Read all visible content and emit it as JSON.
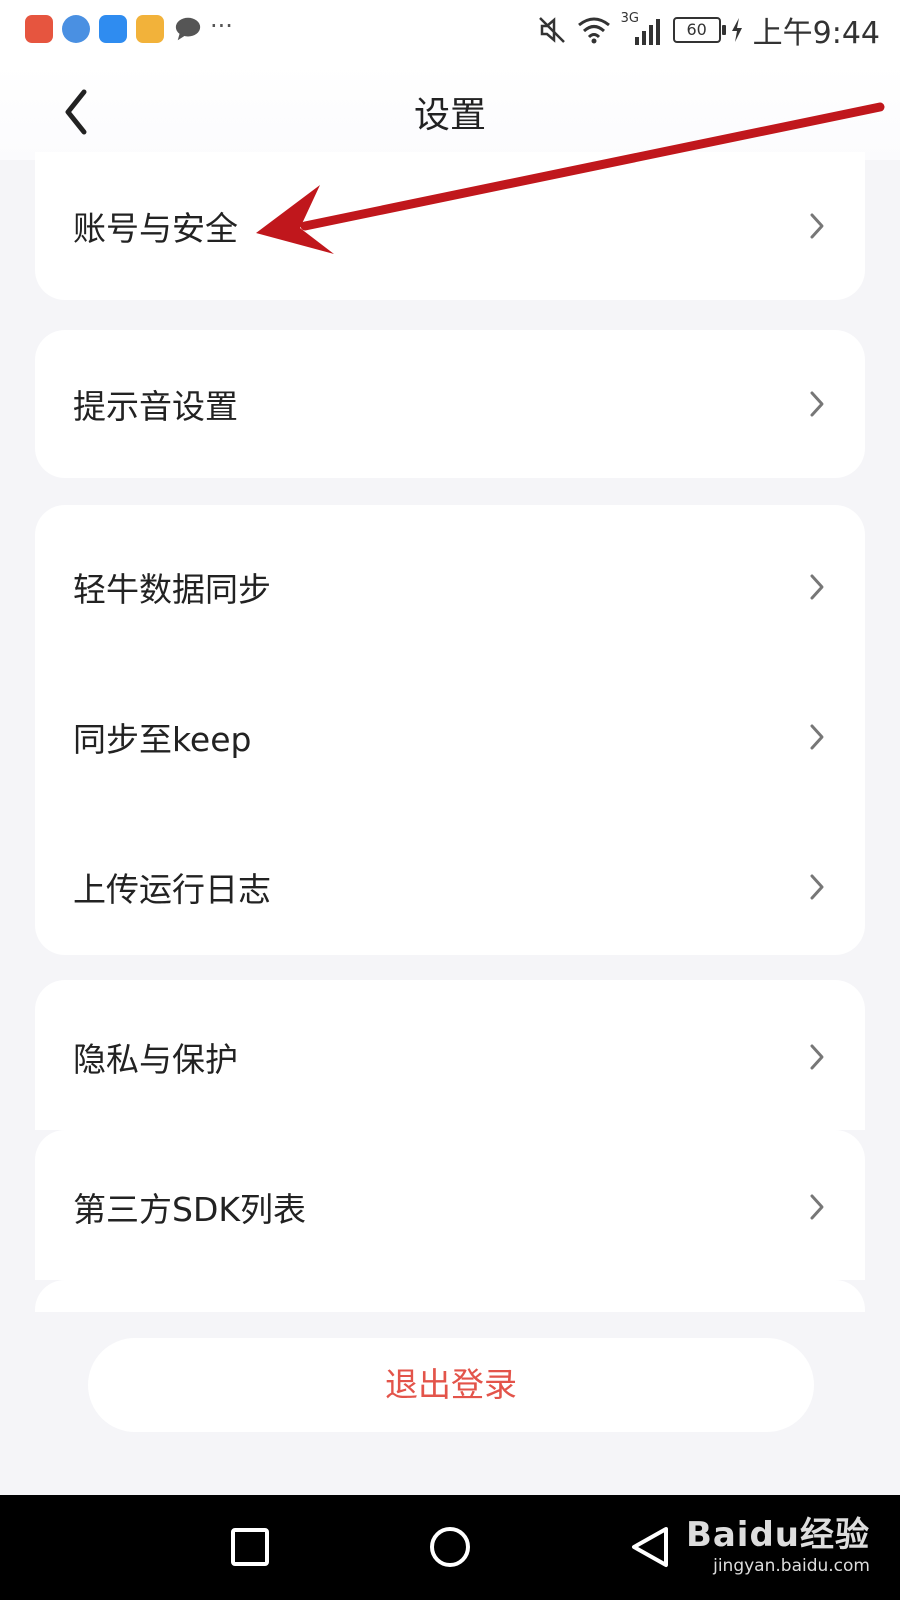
{
  "status_bar": {
    "time": "上午9:44",
    "battery": "60",
    "network": "3G",
    "notification_icons": [
      "huawei-app-icon",
      "browser-icon",
      "shield-app-icon",
      "gift-app-icon",
      "message-icon",
      "more-notifications-icon"
    ]
  },
  "header": {
    "title": "设置"
  },
  "settings": {
    "groups": [
      {
        "items": [
          "账号与安全"
        ]
      },
      {
        "items": [
          "提示音设置"
        ]
      },
      {
        "items": [
          "轻牛数据同步",
          "同步至keep",
          "上传运行日志"
        ]
      },
      {
        "items": [
          "隐私与保护",
          "第三方SDK列表"
        ]
      }
    ]
  },
  "logout_label": "退出登录",
  "watermark": {
    "brand": "Baidu经验",
    "url": "jingyan.baidu.com"
  },
  "colors": {
    "accent_red": "#e3544a",
    "annotation_arrow": "#c0171c",
    "background": "#f5f5f8"
  }
}
